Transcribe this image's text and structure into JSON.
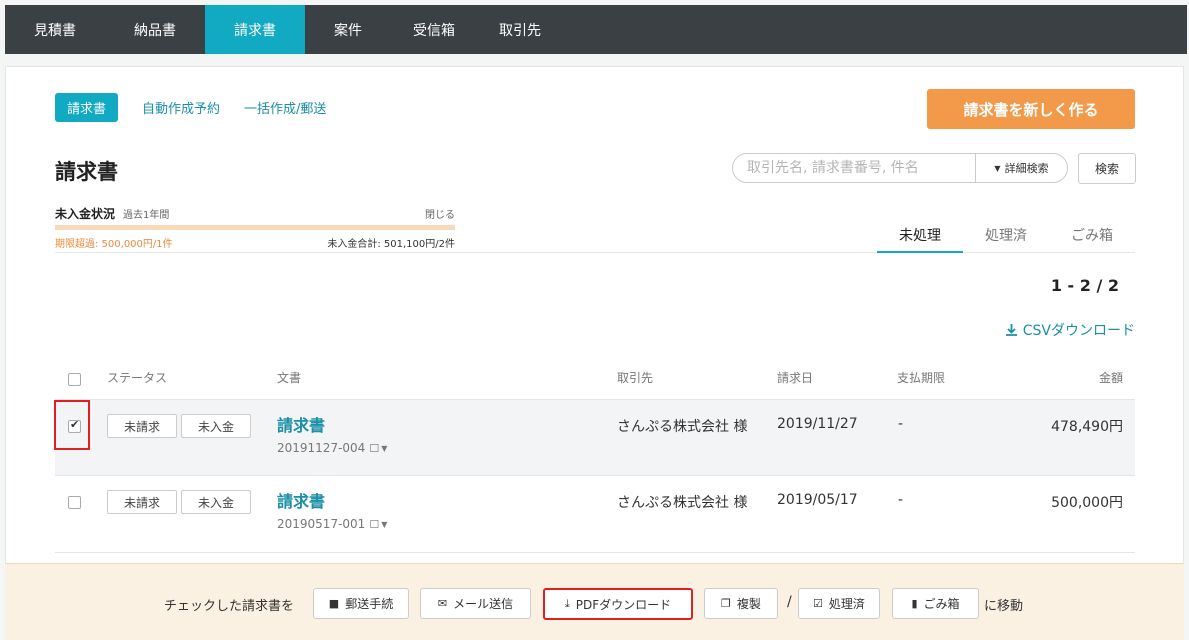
{
  "topnav": {
    "items": [
      {
        "label": "見積書",
        "active": false
      },
      {
        "label": "納品書",
        "active": false
      },
      {
        "label": "請求書",
        "active": true
      },
      {
        "label": "案件",
        "active": false
      },
      {
        "label": "受信箱",
        "active": false
      },
      {
        "label": "取引先",
        "active": false
      }
    ]
  },
  "subnav": {
    "tabs": [
      {
        "label": "請求書",
        "active": true
      },
      {
        "label": "自動作成予約",
        "active": false
      },
      {
        "label": "一括作成/郵送",
        "active": false
      }
    ]
  },
  "new_button": "請求書を新しく作る",
  "page_title": "請求書",
  "search": {
    "placeholder": "取引先名, 請求書番号, 件名",
    "advanced_label": "詳細検索",
    "button_label": "検索"
  },
  "unpaid": {
    "title": "未入金状況",
    "period": "過去1年間",
    "close_label": "閉じる",
    "overdue": "期限超過: 500,000円/1件",
    "total": "未入金合計: 501,100円/2件"
  },
  "status_tabs": [
    {
      "label": "未処理",
      "active": true
    },
    {
      "label": "処理済",
      "active": false
    },
    {
      "label": "ごみ箱",
      "active": false
    }
  ],
  "pagination": "1 - 2 / 2",
  "csv_label": "CSVダウンロード",
  "table": {
    "headers": {
      "status": "ステータス",
      "document": "文書",
      "client": "取引先",
      "invoice_date": "請求日",
      "due_date": "支払期限",
      "amount": "金額"
    },
    "rows": [
      {
        "checked": true,
        "badges": [
          "未請求",
          "未入金"
        ],
        "doc_title": "請求書",
        "doc_no": "20191127-004",
        "client": "さんぷる株式会社 様",
        "invoice_date": "2019/11/27",
        "due_date": "-",
        "amount": "478,490円"
      },
      {
        "checked": false,
        "badges": [
          "未請求",
          "未入金"
        ],
        "doc_title": "請求書",
        "doc_no": "20190517-001",
        "client": "さんぷる株式会社 様",
        "invoice_date": "2019/05/17",
        "due_date": "-",
        "amount": "500,000円"
      }
    ]
  },
  "bottom_bar": {
    "label": "チェックした請求書を",
    "buttons": {
      "mail_post": "郵送手続",
      "email_send": "メール送信",
      "pdf_download": "PDFダウンロード",
      "duplicate": "複製",
      "processed": "処理済",
      "trash": "ごみ箱"
    },
    "separator": "/",
    "move_label": "に移動"
  },
  "colors": {
    "accent": "#12a9c2",
    "link": "#1a8fa6",
    "primary_button": "#f2994a",
    "nav_bg": "#3b4044",
    "highlight_box": "#e02020",
    "overdue": "#e98a3b"
  },
  "icons": {
    "search_caret": "caret-down-icon",
    "csv": "download-icon",
    "doc_comment": "comment-icon",
    "doc_dropdown": "caret-down-icon",
    "mail_post": "truck-icon",
    "email_send": "envelope-icon",
    "pdf_download": "download-icon",
    "duplicate": "copy-icon",
    "processed": "check-square-icon",
    "trash": "trash-icon"
  }
}
